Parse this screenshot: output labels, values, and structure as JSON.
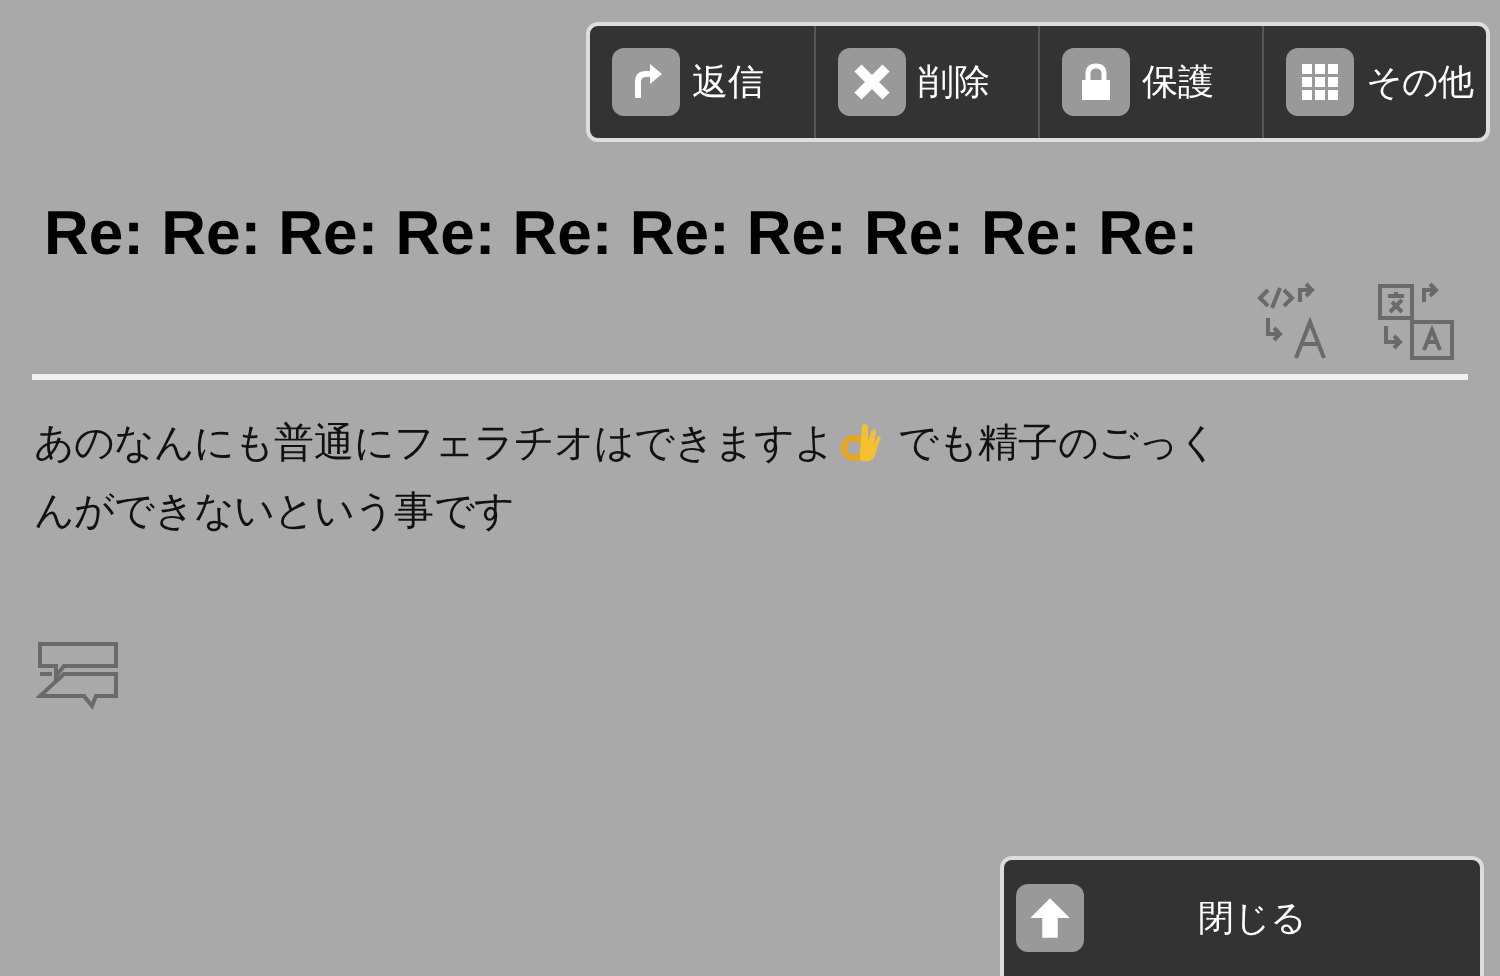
{
  "toolbar": [
    {
      "kind": "reply",
      "label": "返信"
    },
    {
      "kind": "delete",
      "label": "削除"
    },
    {
      "kind": "lock",
      "label": "保護"
    },
    {
      "kind": "more",
      "label": "その他"
    }
  ],
  "title": "Re: Re: Re: Re: Re: Re: Re: Re: Re: Re:",
  "body": {
    "line_1_before": "あのなんにも普通にフェラチオはできますよ",
    "line_1_after": "でも精子のごっく",
    "line_2": "んができないという事です"
  },
  "close_button": {
    "label": "閉じる"
  }
}
